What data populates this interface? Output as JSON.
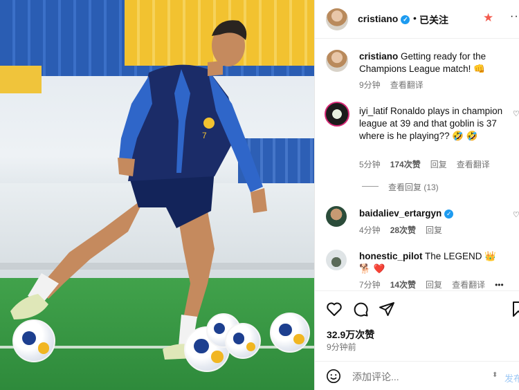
{
  "post": {
    "author": "cristiano",
    "follow_status": "已关注",
    "separator": "•"
  },
  "comments": [
    {
      "username": "cristiano",
      "text": "Getting ready for the Champions League match! 👊",
      "time": "9分钟",
      "translate": "查看翻译"
    },
    {
      "username": "iyi_latif",
      "text": "Ronaldo plays in champion league at 39 and that goblin is 37 where is he playing?? 🤣 🤣",
      "time": "5分钟",
      "likes": "174次赞",
      "reply": "回复",
      "translate": "查看翻译",
      "view_replies": "查看回复 (13)"
    },
    {
      "username": "baidaliev_ertargyn",
      "text": "",
      "time": "4分钟",
      "likes": "28次赞",
      "reply": "回复"
    },
    {
      "username": "honestic_pilot",
      "text": "The LEGEND 👑 🐕 ❤️",
      "time": "7分钟",
      "likes": "14次赞",
      "reply": "回复",
      "translate": "查看翻译",
      "more": "•••"
    }
  ],
  "stats": {
    "likes": "32.9万次赞",
    "posted": "9分钟前"
  },
  "add_comment": {
    "placeholder": "添加评论...",
    "post_label": "发布"
  },
  "colors": {
    "verified": "#1d9bf0",
    "star": "#f35b4e",
    "muted": "#737373"
  },
  "icons": [
    "heart-icon",
    "comment-icon",
    "share-icon",
    "bookmark-icon",
    "emoji-icon",
    "star-icon",
    "more-icon",
    "verified-icon"
  ]
}
